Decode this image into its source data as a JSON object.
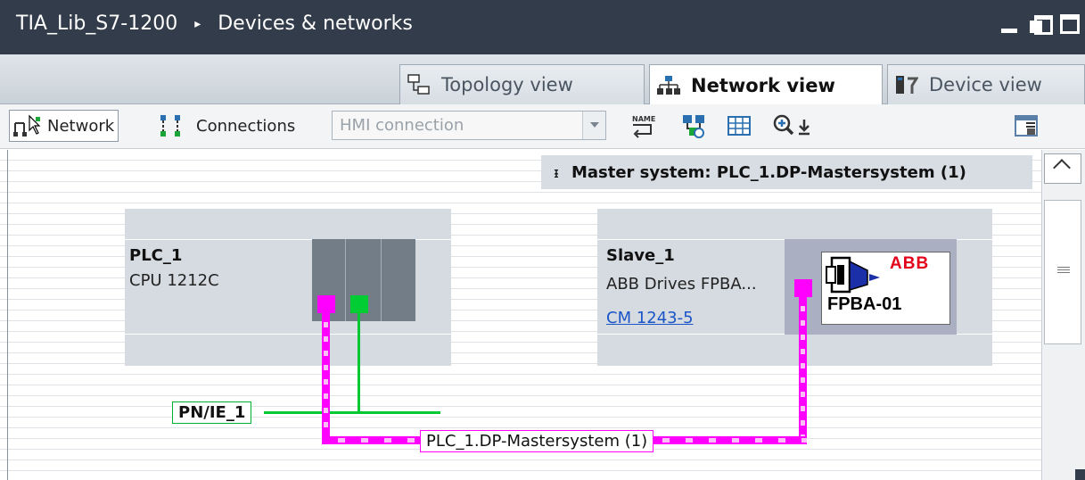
{
  "window": {
    "project": "TIA_Lib_S7-1200",
    "separator": "▸",
    "title": "Devices & networks"
  },
  "tabs": [
    {
      "label": "Topology view",
      "active": false,
      "icon": "topology-icon"
    },
    {
      "label": "Network view",
      "active": true,
      "icon": "network-view-icon"
    },
    {
      "label": "Device view",
      "active": false,
      "icon": "device-view-icon"
    }
  ],
  "toolbar": {
    "network_label": "Network",
    "connections_label": "Connections",
    "connection_type_placeholder": "HMI connection",
    "icons": [
      "name-assign-icon",
      "show-addresses-icon",
      "table-view-icon",
      "zoom-icon",
      "split-view-icon"
    ]
  },
  "canvas": {
    "master_system_bar": "Master system: PLC_1.DP-Mastersystem (1)",
    "devices": [
      {
        "name": "PLC_1",
        "type": "CPU 1212C"
      },
      {
        "name": "Slave_1",
        "type": "ABB Drives FPBA...",
        "link": "CM 1243-5",
        "module_label": "FPBA-01",
        "brand": "ABB"
      }
    ],
    "networks": {
      "profinet": "PN/IE_1",
      "profibus": "PLC_1.DP-Mastersystem (1)"
    }
  },
  "colors": {
    "titlebar": "#323c4a",
    "profibus": "#ff00ff",
    "profinet": "#00c832",
    "link": "#1a55c8"
  }
}
